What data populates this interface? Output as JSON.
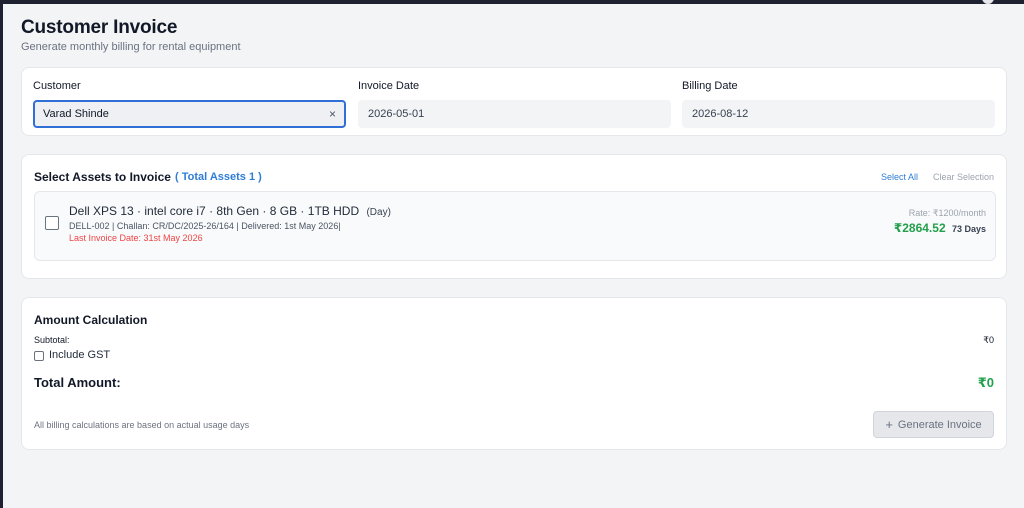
{
  "header": {
    "title": "Customer Invoice",
    "subtitle": "Generate monthly billing for rental equipment"
  },
  "form": {
    "customer_label": "Customer",
    "customer_value": "Varad Shinde",
    "clear_symbol": "×",
    "invoice_date_label": "Invoice Date",
    "invoice_date_value": "2026-05-01",
    "billing_date_label": "Billing Date",
    "billing_date_value": "2026-08-12"
  },
  "assets_section": {
    "title": "Select Assets to Invoice",
    "total_assets": "( Total Assets 1 )",
    "select_all": "Select All",
    "clear_selection": "Clear Selection",
    "items": [
      {
        "name": "Dell XPS 13 · intel core i7 · 8th Gen · 8 GB · 1TB HDD",
        "unit": "(Day)",
        "meta": "DELL-002 |  Challan: CR/DC/2025-26/164 | Delivered: 1st May 2026|",
        "last_invoice": "Last Invoice Date: 31st May 2026",
        "rate": "Rate: ₹1200/month",
        "amount": "₹2864.52",
        "days": "73 Days",
        "selected": false
      }
    ]
  },
  "amount_section": {
    "title": "Amount Calculation",
    "subtotal_label": "Subtotal:",
    "subtotal_value": "₹0",
    "include_gst_label": "Include GST",
    "include_gst_checked": false,
    "total_label": "Total Amount:",
    "total_value": "₹0",
    "footnote": "All billing calculations are based on actual usage days",
    "generate_label": "Generate Invoice",
    "generate_icon": "plus-icon"
  },
  "colors": {
    "accent": "#2f6fd6",
    "link": "#2f7dd6",
    "amount_green": "#22a04b",
    "warning_red": "#ef4444"
  }
}
